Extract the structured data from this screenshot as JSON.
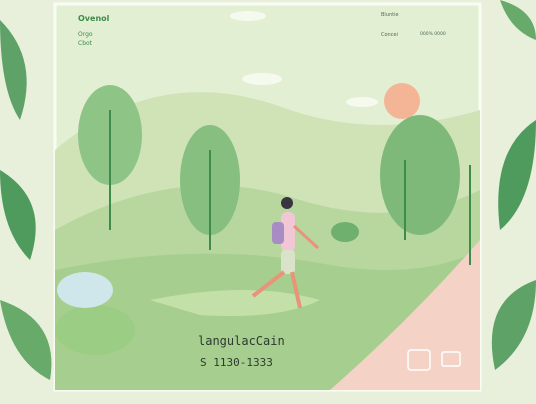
{
  "brand": {
    "title": "Ovenol",
    "subtitle_1": "Orgo",
    "subtitle_2": "Cbot"
  },
  "nav": {
    "item_1": "Bluntie",
    "item_2": "Concei",
    "item_3": "000% 0000"
  },
  "hero": {
    "headline": "langulacCain",
    "subline": "S 1130-1333"
  },
  "colors": {
    "sky": "#e4efd6",
    "hills": "#b9dba3",
    "trees": "#7fbf7a",
    "sun": "#f3b596",
    "path": "#f4d3c6",
    "accent": "#3c8c4a"
  },
  "icons": [
    "leaf-icon",
    "lamp-icon",
    "tablet-icon"
  ]
}
